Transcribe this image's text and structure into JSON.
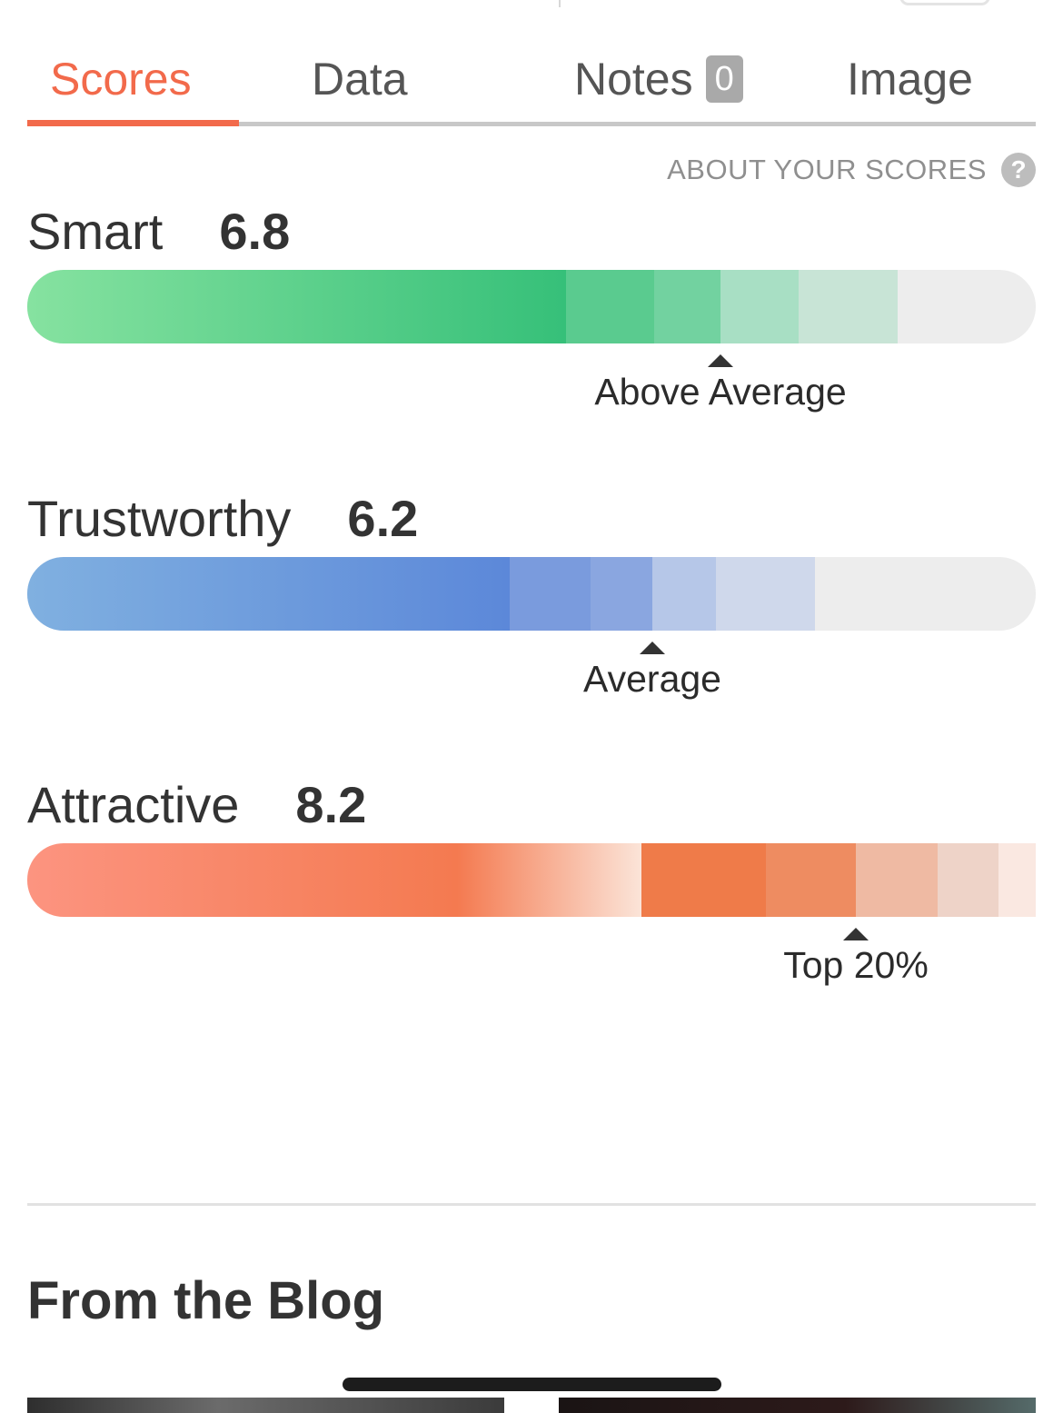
{
  "tabs": [
    {
      "label": "Scores",
      "active": true
    },
    {
      "label": "Data",
      "active": false
    },
    {
      "label": "Notes",
      "badge": "0",
      "active": false
    },
    {
      "label": "Image",
      "active": false
    }
  ],
  "about_link": {
    "label": "ABOUT YOUR SCORES",
    "icon": "help-icon"
  },
  "scores": [
    {
      "label": "Smart",
      "value": "6.8",
      "rating": "Above Average",
      "color": "#36c079"
    },
    {
      "label": "Trustworthy",
      "value": "6.2",
      "rating": "Average",
      "color": "#5c88d9"
    },
    {
      "label": "Attractive",
      "value": "8.2",
      "rating": "Top 20%",
      "color": "#f47a50"
    }
  ],
  "blog": {
    "title": "From the Blog"
  },
  "accent_color": "#f26a4b"
}
